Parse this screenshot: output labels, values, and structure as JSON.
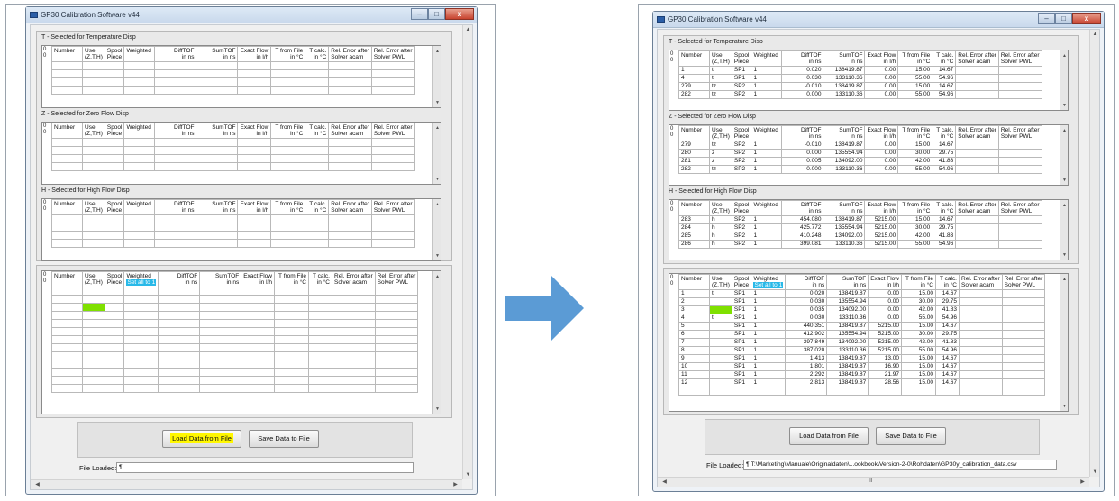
{
  "arrow": {
    "color": "#5b9bd5"
  },
  "columns": [
    {
      "l1": "Number",
      "l2": ""
    },
    {
      "l1": "Use",
      "l2": "(Z,T,H)"
    },
    {
      "l1": "Spool",
      "l2": "Piece"
    },
    {
      "l1": "Weighted",
      "l2": ""
    },
    {
      "l1": "DiffTOF",
      "l2": "in ns"
    },
    {
      "l1": "SumTOF",
      "l2": "in ns"
    },
    {
      "l1": "Exact Flow",
      "l2": "in l/h"
    },
    {
      "l1": "T from File",
      "l2": "in °C"
    },
    {
      "l1": "T calc.",
      "l2": "in °C"
    },
    {
      "l1": "Rel. Error after",
      "l2": "Solver acam"
    },
    {
      "l1": "Rel. Error after",
      "l2": "Solver PWL"
    }
  ],
  "left": {
    "title": "GP30 Calibration Software v44",
    "controls": [
      "–",
      "□",
      "x"
    ],
    "corner": "0\n0",
    "sections": [
      {
        "title": "T - Selected for Temperature Disp"
      },
      {
        "title": "Z - Selected for Zero Flow Disp"
      },
      {
        "title": "H - Selected for High Flow Disp"
      }
    ],
    "set_all": "Set all to 1",
    "load_button": "Load Data from File",
    "save_button": "Save Data to File",
    "file_loaded_label": "File Loaded:",
    "file_loaded_value": ""
  },
  "right": {
    "title": "GP30 Calibration Software v44",
    "controls": [
      "–",
      "□",
      "x"
    ],
    "corner": "0\n0",
    "sections": [
      {
        "title": "T - Selected for Temperature Disp",
        "rows": [
          [
            "1",
            "t",
            "SP1",
            "1",
            "0.020",
            "138419.87",
            "0.00",
            "15.00",
            "14.67"
          ],
          [
            "4",
            "t",
            "SP1",
            "1",
            "0.030",
            "133110.36",
            "0.00",
            "55.00",
            "54.96"
          ],
          [
            "279",
            "tz",
            "SP2",
            "1",
            "-0.010",
            "138419.87",
            "0.00",
            "15.00",
            "14.67"
          ],
          [
            "282",
            "tz",
            "SP2",
            "1",
            "0.000",
            "133110.36",
            "0.00",
            "55.00",
            "54.96"
          ]
        ]
      },
      {
        "title": "Z - Selected for Zero Flow Disp",
        "rows": [
          [
            "279",
            "tz",
            "SP2",
            "1",
            "-0.010",
            "138419.87",
            "0.00",
            "15.00",
            "14.67"
          ],
          [
            "280",
            "z",
            "SP2",
            "1",
            "0.000",
            "135554.94",
            "0.00",
            "30.00",
            "29.75"
          ],
          [
            "281",
            "z",
            "SP2",
            "1",
            "0.005",
            "134092.00",
            "0.00",
            "42.00",
            "41.83"
          ],
          [
            "282",
            "tz",
            "SP2",
            "1",
            "0.000",
            "133110.36",
            "0.00",
            "55.00",
            "54.96"
          ]
        ]
      },
      {
        "title": "H - Selected for High Flow Disp",
        "rows": [
          [
            "283",
            "h",
            "SP2",
            "1",
            "454.080",
            "138419.87",
            "5215.00",
            "15.00",
            "14.67"
          ],
          [
            "284",
            "h",
            "SP2",
            "1",
            "425.772",
            "135554.94",
            "5215.00",
            "30.00",
            "29.75"
          ],
          [
            "285",
            "h",
            "SP2",
            "1",
            "410.248",
            "134092.00",
            "5215.00",
            "42.00",
            "41.83"
          ],
          [
            "286",
            "h",
            "SP2",
            "1",
            "399.081",
            "133110.36",
            "5215.00",
            "55.00",
            "54.96"
          ]
        ]
      }
    ],
    "set_all": "Set all to 1",
    "main_rows": [
      [
        "1",
        "t",
        "SP1",
        "1",
        "0.020",
        "138419.87",
        "0.00",
        "15.00",
        "14.67"
      ],
      [
        "2",
        "",
        "SP1",
        "1",
        "0.030",
        "135554.94",
        "0.00",
        "30.00",
        "29.75"
      ],
      [
        "3",
        "",
        "SP1",
        "1",
        "0.035",
        "134092.00",
        "0.00",
        "42.00",
        "41.83"
      ],
      [
        "4",
        "t",
        "SP1",
        "1",
        "0.030",
        "133110.36",
        "0.00",
        "55.00",
        "54.96"
      ],
      [
        "5",
        "",
        "SP1",
        "1",
        "440.351",
        "138419.87",
        "5215.00",
        "15.00",
        "14.67"
      ],
      [
        "6",
        "",
        "SP1",
        "1",
        "412.902",
        "135554.94",
        "5215.00",
        "30.00",
        "29.75"
      ],
      [
        "7",
        "",
        "SP1",
        "1",
        "397.849",
        "134092.00",
        "5215.00",
        "42.00",
        "41.83"
      ],
      [
        "8",
        "",
        "SP1",
        "1",
        "387.020",
        "133110.36",
        "5215.00",
        "55.00",
        "54.96"
      ],
      [
        "9",
        "",
        "SP1",
        "1",
        "1.413",
        "138419.87",
        "13.00",
        "15.00",
        "14.67"
      ],
      [
        "10",
        "",
        "SP1",
        "1",
        "1.801",
        "138419.87",
        "16.90",
        "15.00",
        "14.67"
      ],
      [
        "11",
        "",
        "SP1",
        "1",
        "2.292",
        "138419.87",
        "21.97",
        "15.00",
        "14.67"
      ],
      [
        "12",
        "",
        "SP1",
        "1",
        "2.813",
        "138419.87",
        "28.56",
        "15.00",
        "14.67"
      ]
    ],
    "load_button": "Load Data from File",
    "save_button": "Save Data to File",
    "file_loaded_label": "File Loaded:",
    "file_loaded_value": "T:\\Marketing\\Manuale\\Originaldaten\\...ookbook\\Version-2-0\\Rohdaten\\GP30y_calibration_data.csv",
    "hscroll_mark": "III"
  }
}
